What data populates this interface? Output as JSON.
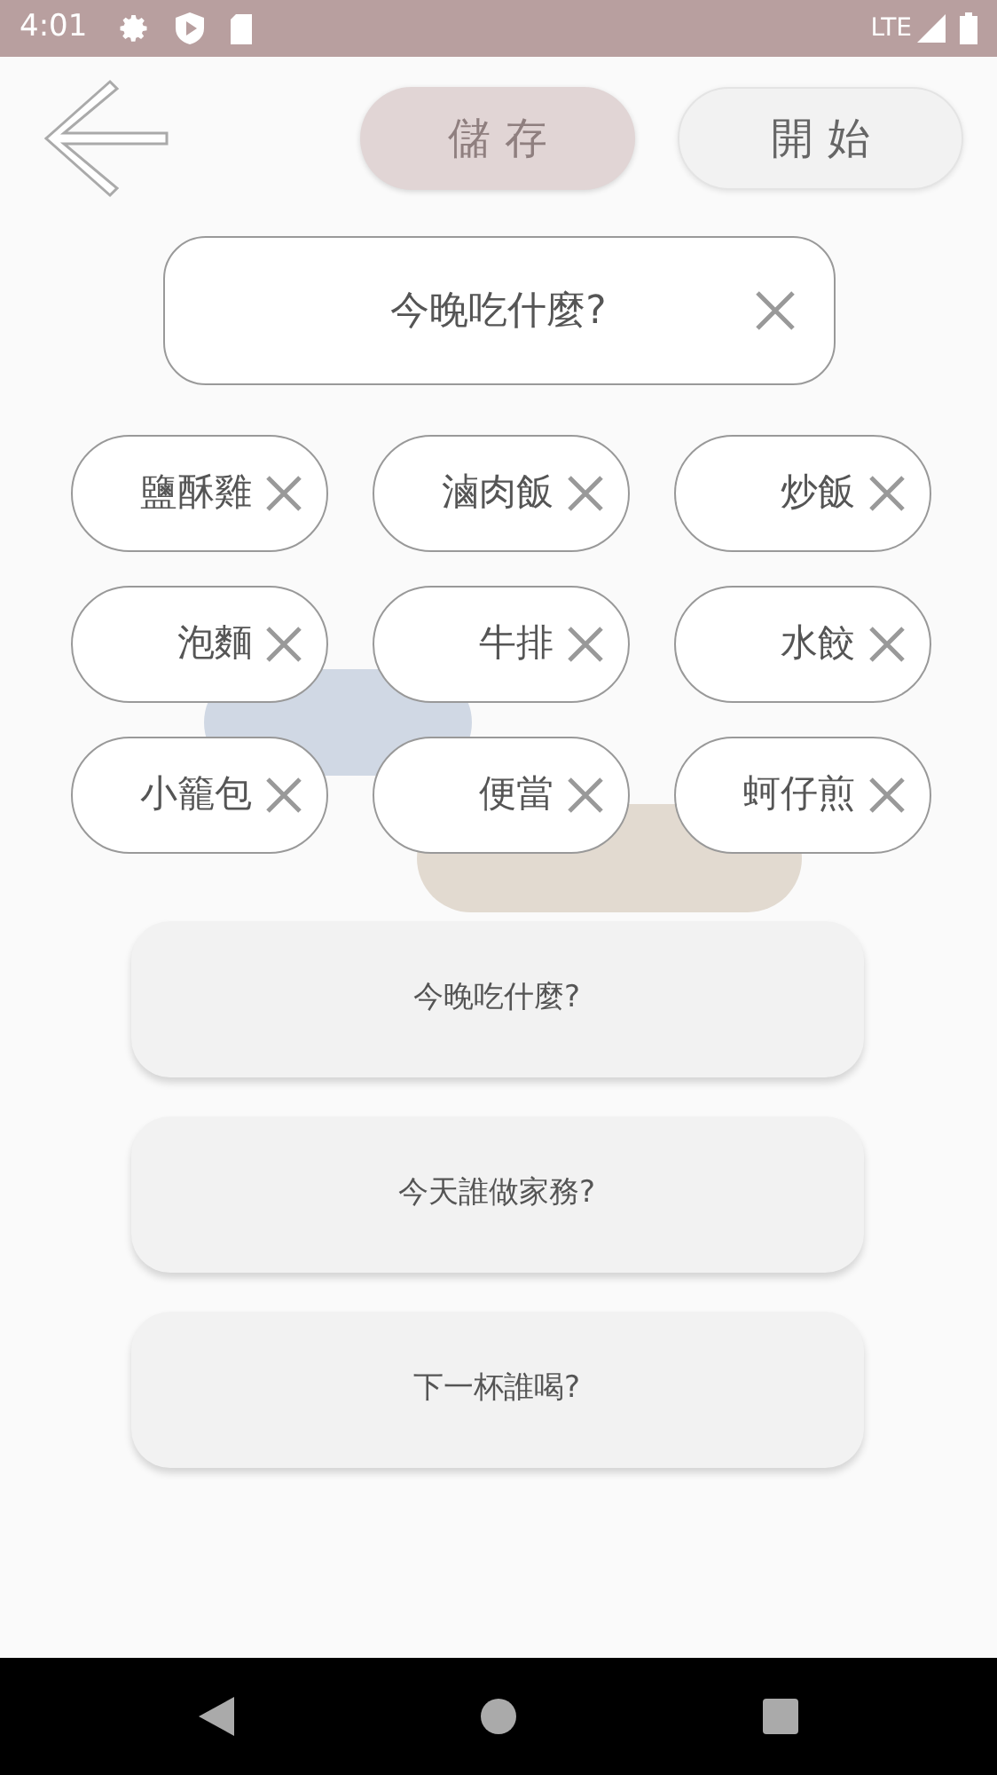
{
  "status_bar": {
    "time": "4:01",
    "network": "LTE"
  },
  "toolbar": [
    {
      "label": "儲 存",
      "disabled": true
    },
    {
      "label": "開 始",
      "disabled": false
    }
  ],
  "title_field": {
    "value": "今晚吃什麼?"
  },
  "chips": [
    {
      "label": "鹽酥雞"
    },
    {
      "label": "滷肉飯"
    },
    {
      "label": "炒飯"
    },
    {
      "label": "泡麵"
    },
    {
      "label": "牛排"
    },
    {
      "label": "水餃"
    },
    {
      "label": "小籠包"
    },
    {
      "label": "便當"
    },
    {
      "label": "蚵仔煎"
    }
  ],
  "presets": [
    {
      "label": "今晚吃什麼?"
    },
    {
      "label": "今天誰做家務?"
    },
    {
      "label": "下一杯誰喝?"
    }
  ]
}
